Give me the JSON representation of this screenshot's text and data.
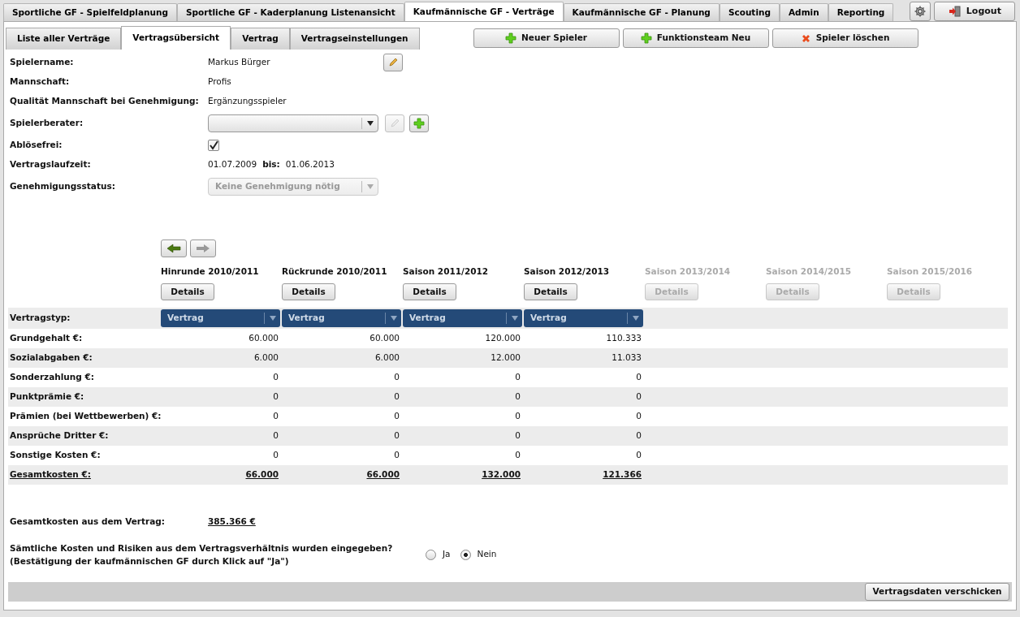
{
  "main_tabs": [
    {
      "label": "Sportliche GF - Spielfeldplanung",
      "selected": false
    },
    {
      "label": "Sportliche GF - Kaderplanung Listenansicht",
      "selected": false
    },
    {
      "label": "Kaufmännische GF - Verträge",
      "selected": true
    },
    {
      "label": "Kaufmännische GF - Planung",
      "selected": false
    },
    {
      "label": "Scouting",
      "selected": false
    },
    {
      "label": "Admin",
      "selected": false
    },
    {
      "label": "Reporting",
      "selected": false
    }
  ],
  "logout": "Logout",
  "sub_tabs": [
    {
      "label": "Liste aller Verträge",
      "selected": false
    },
    {
      "label": "Vertragsübersicht",
      "selected": true
    },
    {
      "label": "Vertrag",
      "selected": false
    },
    {
      "label": "Vertragseinstellungen",
      "selected": false
    }
  ],
  "actions": [
    {
      "label": "Neuer Spieler",
      "kind": "add"
    },
    {
      "label": "Funktionsteam Neu",
      "kind": "add"
    },
    {
      "label": "Spieler löschen",
      "kind": "delete"
    }
  ],
  "fields": [
    {
      "kind": "text",
      "label": "Spielername:",
      "value": "Markus Bürger",
      "editable": true
    },
    {
      "kind": "text",
      "label": "Mannschaft:",
      "value": "Profis"
    },
    {
      "kind": "text",
      "label": "Qualität Mannschaft bei Genehmigung:",
      "value": "Ergänzungsspieler"
    },
    {
      "kind": "select",
      "label": "Spielerberater:",
      "disabled": false,
      "with_buttons": true
    },
    {
      "kind": "checkbox",
      "label": "Ablösefrei:",
      "checked": true
    },
    {
      "kind": "range",
      "label": "Vertragslaufzeit:",
      "from": "01.07.2009",
      "to_label": "bis:",
      "to": "01.06.2013"
    },
    {
      "kind": "select",
      "label": "Genehmigungsstatus:",
      "value": "Keine Genehmigung nötig",
      "disabled": true
    }
  ],
  "seasons": [
    {
      "label": "Hinrunde 2010/2011",
      "enabled": true,
      "button": "Details",
      "contract_type": "Vertrag"
    },
    {
      "label": "Rückrunde 2010/2011",
      "enabled": true,
      "button": "Details",
      "contract_type": "Vertrag"
    },
    {
      "label": "Saison 2011/2012",
      "enabled": true,
      "button": "Details",
      "contract_type": "Vertrag"
    },
    {
      "label": "Saison 2012/2013",
      "enabled": true,
      "button": "Details",
      "contract_type": "Vertrag"
    },
    {
      "label": "Saison 2013/2014",
      "enabled": false,
      "button": "Details"
    },
    {
      "label": "Saison 2014/2015",
      "enabled": false,
      "button": "Details"
    },
    {
      "label": "Saison 2015/2016",
      "enabled": false,
      "button": "Details"
    }
  ],
  "contract_type_label": "Vertragstyp:",
  "rows": [
    {
      "kind": "plain",
      "label": "Grundgehalt €:",
      "values": [
        "60.000",
        "60.000",
        "120.000",
        "110.333"
      ]
    },
    {
      "kind": "plain",
      "label": "Sozialabgaben €:",
      "values": [
        "6.000",
        "6.000",
        "12.000",
        "11.033"
      ]
    },
    {
      "kind": "plain",
      "label": "Sonderzahlung €:",
      "values": [
        "0",
        "0",
        "0",
        "0"
      ]
    },
    {
      "kind": "plain",
      "label": "Punktprämie €:",
      "values": [
        "0",
        "0",
        "0",
        "0"
      ]
    },
    {
      "kind": "plain",
      "label": "Prämien (bei Wettbewerben) €:",
      "values": [
        "0",
        "0",
        "0",
        "0"
      ]
    },
    {
      "kind": "plain",
      "label": "Ansprüche Dritter €:",
      "values": [
        "0",
        "0",
        "0",
        "0"
      ]
    },
    {
      "kind": "plain",
      "label": "Sonstige Kosten €:",
      "values": [
        "0",
        "0",
        "0",
        "0"
      ]
    },
    {
      "kind": "total",
      "label": "Gesamtkosten €:",
      "values": [
        "66.000",
        "66.000",
        "132.000",
        "121.366"
      ]
    }
  ],
  "summary": {
    "label": "Gesamtkosten aus dem Vertrag:",
    "value": "385.366 €"
  },
  "confirmation": {
    "question": "Sämtliche Kosten und Risiken aus dem Vertragsverhältnis wurden eingegeben?",
    "hint": "(Bestätigung der kaufmännischen GF durch Klick auf \"Ja\")",
    "options": [
      {
        "label": "Ja",
        "selected": false
      },
      {
        "label": "Nein",
        "selected": true
      }
    ]
  },
  "submit": "Vertragsdaten verschicken"
}
